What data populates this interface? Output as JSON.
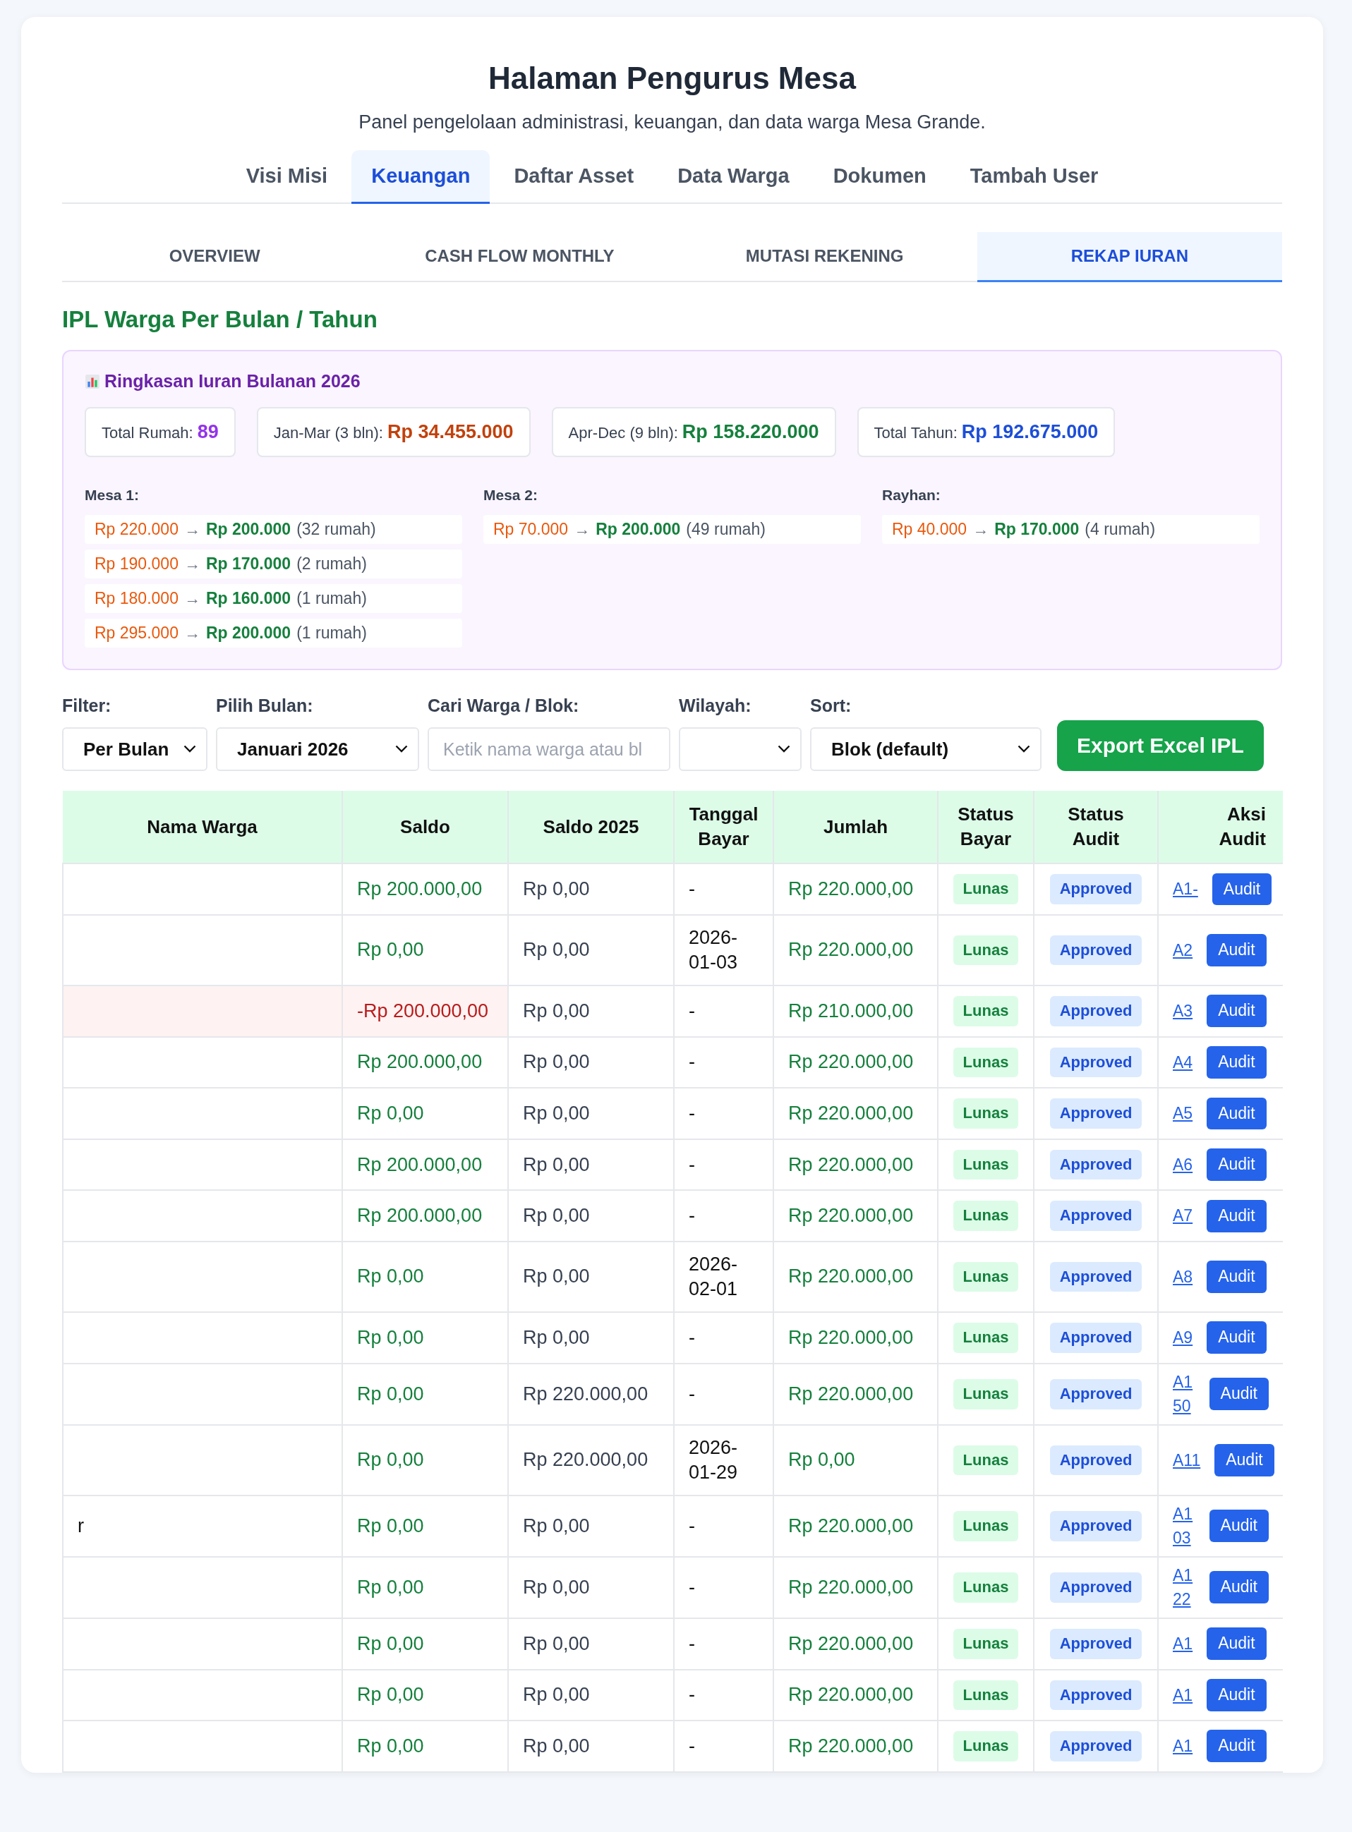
{
  "header": {
    "title": "Halaman Pengurus Mesa",
    "subtitle": "Panel pengelolaan administrasi, keuangan, dan data warga Mesa Grande."
  },
  "tabs": [
    {
      "label": "Visi Misi",
      "selected": false
    },
    {
      "label": "Keuangan",
      "selected": true
    },
    {
      "label": "Daftar Asset",
      "selected": false
    },
    {
      "label": "Data Warga",
      "selected": false
    },
    {
      "label": "Dokumen",
      "selected": false
    },
    {
      "label": "Tambah User",
      "selected": false
    }
  ],
  "subtabs": [
    {
      "label": "OVERVIEW",
      "selected": false
    },
    {
      "label": "CASH FLOW MONTHLY",
      "selected": false
    },
    {
      "label": "MUTASI REKENING",
      "selected": false
    },
    {
      "label": "REKAP IURAN",
      "selected": true
    }
  ],
  "section_title": "IPL Warga Per Bulan / Tahun",
  "summary": {
    "title": "Ringkasan Iuran Bulanan 2026",
    "stats": [
      {
        "label": "Total Rumah:",
        "value": "89",
        "color": "#9333ea"
      },
      {
        "label": "Jan-Mar (3 bln):",
        "value": "Rp 34.455.000",
        "color": "#c2410c"
      },
      {
        "label": "Apr-Dec (9 bln):",
        "value": "Rp 158.220.000",
        "color": "#15803d"
      },
      {
        "label": "Total Tahun:",
        "value": "Rp 192.675.000",
        "color": "#1d4ed8"
      }
    ],
    "groups": [
      {
        "name": "Mesa 1:",
        "items": [
          {
            "from": "Rp 220.000",
            "arrow": "→",
            "to": "Rp 200.000",
            "count": "(32 rumah)"
          },
          {
            "from": "Rp 190.000",
            "arrow": "→",
            "to": "Rp 170.000",
            "count": "(2 rumah)"
          },
          {
            "from": "Rp 180.000",
            "arrow": "→",
            "to": "Rp 160.000",
            "count": "(1 rumah)"
          },
          {
            "from": "Rp 295.000",
            "arrow": "→",
            "to": "Rp 200.000",
            "count": "(1 rumah)"
          }
        ]
      },
      {
        "name": "Mesa 2:",
        "items": [
          {
            "from": "Rp 70.000",
            "arrow": "→",
            "to": "Rp 200.000",
            "count": "(49 rumah)"
          }
        ]
      },
      {
        "name": "Rayhan:",
        "items": [
          {
            "from": "Rp 40.000",
            "arrow": "→",
            "to": "Rp 170.000",
            "count": "(4 rumah)"
          }
        ]
      }
    ]
  },
  "filters": {
    "filter": {
      "label": "Filter:",
      "value": "Per Bulan"
    },
    "month": {
      "label": "Pilih Bulan:",
      "value": "Januari 2026"
    },
    "search": {
      "label": "Cari Warga / Blok:",
      "placeholder": "Ketik nama warga atau bl"
    },
    "region": {
      "label": "Wilayah:"
    },
    "sort": {
      "label": "Sort:",
      "value": "Blok (default)"
    },
    "export_button": "Export Excel IPL"
  },
  "table": {
    "columns": [
      "Nama Warga",
      "Saldo",
      "Saldo 2025",
      "Tanggal Bayar",
      "Jumlah",
      "Status Bayar",
      "Status Audit",
      "Aksi Audit"
    ],
    "rows": [
      {
        "saldo": "Rp 200.000,00",
        "negative": false,
        "saldo_2025": "Rp 0,00",
        "tanggal": "-",
        "jumlah": "Rp 220.000,00",
        "status_bayar": "Lunas",
        "status_audit": "Approved",
        "link": "A1-",
        "action": "Audit"
      },
      {
        "saldo": "Rp 0,00",
        "negative": false,
        "saldo_2025": "Rp 0,00",
        "tanggal": "2026-01-03",
        "jumlah": "Rp 220.000,00",
        "status_bayar": "Lunas",
        "status_audit": "Approved",
        "link": "A2",
        "action": "Audit"
      },
      {
        "saldo": "-Rp 200.000,00",
        "negative": true,
        "saldo_2025": "Rp 0,00",
        "tanggal": "-",
        "jumlah": "Rp 210.000,00",
        "status_bayar": "Lunas",
        "status_audit": "Approved",
        "link": "A3",
        "action": "Audit"
      },
      {
        "saldo": "Rp 200.000,00",
        "negative": false,
        "saldo_2025": "Rp 0,00",
        "tanggal": "-",
        "jumlah": "Rp 220.000,00",
        "status_bayar": "Lunas",
        "status_audit": "Approved",
        "link": "A4",
        "action": "Audit"
      },
      {
        "saldo": "Rp 0,00",
        "negative": false,
        "saldo_2025": "Rp 0,00",
        "tanggal": "-",
        "jumlah": "Rp 220.000,00",
        "status_bayar": "Lunas",
        "status_audit": "Approved",
        "link": "A5",
        "action": "Audit"
      },
      {
        "saldo": "Rp 200.000,00",
        "negative": false,
        "saldo_2025": "Rp 0,00",
        "tanggal": "-",
        "jumlah": "Rp 220.000,00",
        "status_bayar": "Lunas",
        "status_audit": "Approved",
        "link": "A6",
        "action": "Audit"
      },
      {
        "saldo": "Rp 200.000,00",
        "negative": false,
        "saldo_2025": "Rp 0,00",
        "tanggal": "-",
        "jumlah": "Rp 220.000,00",
        "status_bayar": "Lunas",
        "status_audit": "Approved",
        "link": "A7",
        "action": "Audit"
      },
      {
        "saldo": "Rp 0,00",
        "negative": false,
        "saldo_2025": "Rp 0,00",
        "tanggal": "2026-02-01",
        "jumlah": "Rp 220.000,00",
        "status_bayar": "Lunas",
        "status_audit": "Approved",
        "link": "A8",
        "action": "Audit"
      },
      {
        "saldo": "Rp 0,00",
        "negative": false,
        "saldo_2025": "Rp 0,00",
        "tanggal": "-",
        "jumlah": "Rp 220.000,00",
        "status_bayar": "Lunas",
        "status_audit": "Approved",
        "link": "A9",
        "action": "Audit"
      },
      {
        "saldo": "Rp 0,00",
        "negative": false,
        "saldo_2025": "Rp 220.000,00",
        "tanggal": "-",
        "jumlah": "Rp 220.000,00",
        "status_bayar": "Lunas",
        "status_audit": "Approved",
        "link": "A1 50",
        "action": "Audit"
      },
      {
        "saldo": "Rp 0,00",
        "negative": false,
        "saldo_2025": "Rp 220.000,00",
        "tanggal": "2026-01-29",
        "jumlah": "Rp 0,00",
        "status_bayar": "Lunas",
        "status_audit": "Approved",
        "link": "A11",
        "action": "Audit"
      },
      {
        "name": "r",
        "saldo": "Rp 0,00",
        "negative": false,
        "saldo_2025": "Rp 0,00",
        "tanggal": "-",
        "jumlah": "Rp 220.000,00",
        "status_bayar": "Lunas",
        "status_audit": "Approved",
        "link": "A1 03",
        "action": "Audit"
      },
      {
        "saldo": "Rp 0,00",
        "negative": false,
        "saldo_2025": "Rp 0,00",
        "tanggal": "-",
        "jumlah": "Rp 220.000,00",
        "status_bayar": "Lunas",
        "status_audit": "Approved",
        "link": "A1 22",
        "action": "Audit"
      },
      {
        "saldo": "Rp 0,00",
        "negative": false,
        "saldo_2025": "Rp 0,00",
        "tanggal": "-",
        "jumlah": "Rp 220.000,00",
        "status_bayar": "Lunas",
        "status_audit": "Approved",
        "link": "A1",
        "action": "Audit"
      },
      {
        "saldo": "Rp 0,00",
        "negative": false,
        "saldo_2025": "Rp 0,00",
        "tanggal": "-",
        "jumlah": "Rp 220.000,00",
        "status_bayar": "Lunas",
        "status_audit": "Approved",
        "link": "A1",
        "action": "Audit"
      },
      {
        "saldo": "Rp 0,00",
        "negative": false,
        "saldo_2025": "Rp 0,00",
        "tanggal": "-",
        "jumlah": "Rp 220.000,00",
        "status_bayar": "Lunas",
        "status_audit": "Approved",
        "link": "A1",
        "action": "Audit"
      }
    ]
  }
}
